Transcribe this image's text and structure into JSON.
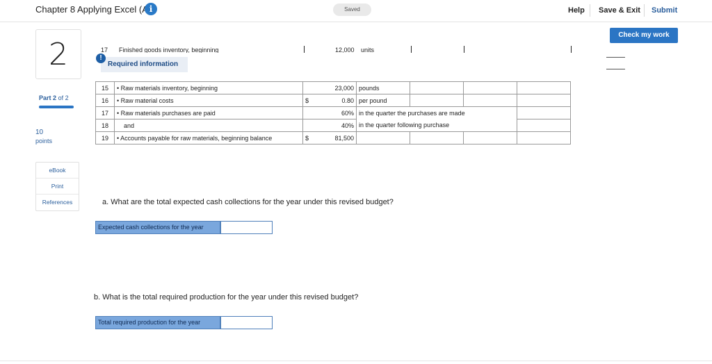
{
  "header": {
    "title": "Chapter 8 Applying Excel (A)",
    "info_icon": "i",
    "saved": "Saved",
    "help": "Help",
    "save_exit": "Save & Exit",
    "submit": "Submit",
    "check_my_work": "Check my work"
  },
  "sidebar": {
    "question_number": "2",
    "part_label": "Part",
    "part_current": "2",
    "part_of": "of 2",
    "points": "10",
    "points_label": "points",
    "links": [
      "eBook",
      "Print",
      "References"
    ]
  },
  "sheet": {
    "cut_row_num": "17",
    "cut_row_text": "Finished goods inventory, beginning",
    "cut_row_value": "12,000",
    "cut_row_unit": "units",
    "alert_icon": "!",
    "required_tab": "Required information",
    "rows": [
      {
        "n": "15",
        "label": "Raw materials inventory, beginning",
        "dollar": "",
        "value": "23,000",
        "unit": "pounds"
      },
      {
        "n": "16",
        "label": "Raw material costs",
        "dollar": "$",
        "value": "0.80",
        "unit": "per pound"
      },
      {
        "n": "17",
        "label": "Raw materials purchases are paid",
        "dollar": "",
        "value": "60%",
        "unit": "in the quarter the purchases are made"
      },
      {
        "n": "18",
        "label": "and",
        "dollar": "",
        "value": "40%",
        "unit": "in the quarter following purchase"
      },
      {
        "n": "19",
        "label": "Accounts payable for raw materials, beginning balance",
        "dollar": "$",
        "value": "81,500",
        "unit": ""
      }
    ]
  },
  "questions": {
    "a_text": "a. What are the total expected cash collections for the year under this revised budget?",
    "a_label": "Expected cash collections for the year",
    "a_value": "",
    "b_text": "b. What is the total required production for the year under this revised budget?",
    "b_label": "Total required production for the year",
    "b_value": ""
  },
  "colors": {
    "accent": "#2b75c4",
    "answer_label_bg": "#7aa7dd"
  }
}
